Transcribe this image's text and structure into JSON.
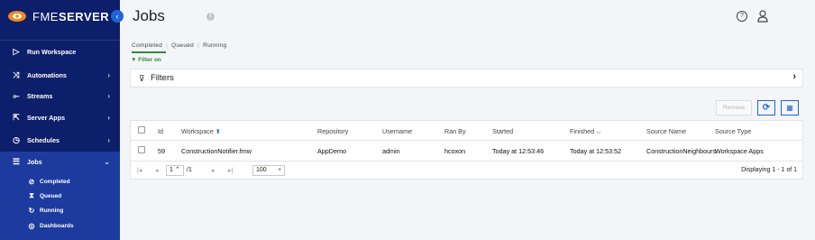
{
  "app": {
    "name": "FME",
    "name_bold": "SERVER",
    "collapse_glyph": "‹"
  },
  "nav": [
    {
      "label": "Run Workspace",
      "icon": "▷",
      "icon_name": "play-icon",
      "chev": ""
    },
    {
      "label": "Automations",
      "icon": "⤨",
      "icon_name": "shuffle-icon",
      "chev": "›"
    },
    {
      "label": "Streams",
      "icon": "⟜",
      "icon_name": "stream-icon",
      "chev": "›"
    },
    {
      "label": "Server Apps",
      "icon": "⇱",
      "icon_name": "server-apps-icon",
      "chev": "›"
    },
    {
      "label": "Schedules",
      "icon": "◷",
      "icon_name": "clock-icon",
      "chev": "›"
    },
    {
      "label": "Jobs",
      "icon": "☰",
      "icon_name": "jobs-list-icon",
      "chev": "⌄"
    }
  ],
  "jobs_sub": [
    {
      "label": "Completed",
      "icon": "⊘",
      "icon_name": "check-circle-icon"
    },
    {
      "label": "Queued",
      "icon": "⧗",
      "icon_name": "hourglass-icon"
    },
    {
      "label": "Running",
      "icon": "↻",
      "icon_name": "running-icon"
    },
    {
      "label": "Dashboards",
      "icon": "◎",
      "icon_name": "dashboard-icon"
    }
  ],
  "page": {
    "title": "Jobs",
    "info_glyph": "i",
    "help_glyph": "?"
  },
  "tabs": [
    {
      "label": "Completed",
      "active": true
    },
    {
      "label": "Queued",
      "active": false
    },
    {
      "label": "Running",
      "active": false
    }
  ],
  "filter_on": {
    "icon": "▼",
    "label": "Filter on"
  },
  "filters": {
    "icon": "⊽",
    "label": "Filters",
    "chev": "›"
  },
  "toolbar": {
    "remove": "Remove",
    "refresh": "⟳",
    "columns": "▦"
  },
  "table": {
    "columns": [
      "Id",
      "Workspace",
      "Repository",
      "Username",
      "Ran By",
      "Started",
      "Finished",
      "Source Name",
      "Source Type"
    ],
    "sort_glyph": "⬍",
    "finished_glyph": "⌵",
    "rows": [
      {
        "id": "59",
        "workspace": "ConstructionNotifier.fmw",
        "repository": "AppDemo",
        "username": "admin",
        "ran_by": "hcoxon",
        "started": "Today at 12:53:46",
        "finished": "Today at 12:53:52",
        "source_name": "ConstructionNeighbours",
        "source_type": "Workspace Apps"
      }
    ]
  },
  "pager": {
    "first": "|◂",
    "prev": "◂",
    "page": "1",
    "page_spin": "⌃",
    "of": "/1",
    "next": "▸",
    "last": "▸|",
    "per_page": "100",
    "per_page_caret": "▾",
    "info": "Displaying 1 - 1 of 1"
  },
  "colors": {
    "sidebar": "#0d1f6b",
    "sidebar_active": "#1d3a9e",
    "accent": "#1f63d8",
    "green": "#2f8c3a",
    "logo_orange": "#f08a1c"
  }
}
